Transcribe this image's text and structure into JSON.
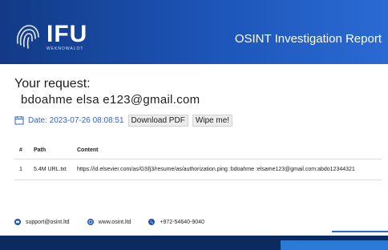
{
  "header": {
    "logo_text": "IFU",
    "logo_tagline": "WEKNOWALOT",
    "title": "OSINT Investigation Report"
  },
  "request": {
    "label": "Your request:",
    "email": "bdoahme        elsa    e123@gmail.com"
  },
  "date": {
    "text": "Date: 2023-07-26 08:08:51"
  },
  "actions": {
    "download_label": "Download PDF",
    "wipe_label": "Wipe me!"
  },
  "table": {
    "headers": [
      "#",
      "Path",
      "Content"
    ],
    "rows": [
      {
        "num": "1",
        "path": "5.4M URL.txt",
        "content": "https://id.elsevier.com/as/GSfj3/resume/as/authorization.ping  :bdoahme       :elsame123@gmail.com:abdo12344321"
      }
    ]
  },
  "footer": {
    "email": "support@osint.ltd",
    "website": "www.osint.ltd",
    "phone": "+972-54640-9040"
  },
  "colors": {
    "header_blue": "#1d55b8",
    "accent_blue": "#2a6ad3",
    "date_blue": "#3a62c0"
  },
  "icons": [
    "fingerprint-icon",
    "calendar-icon",
    "mail-icon",
    "globe-icon",
    "phone-icon"
  ]
}
